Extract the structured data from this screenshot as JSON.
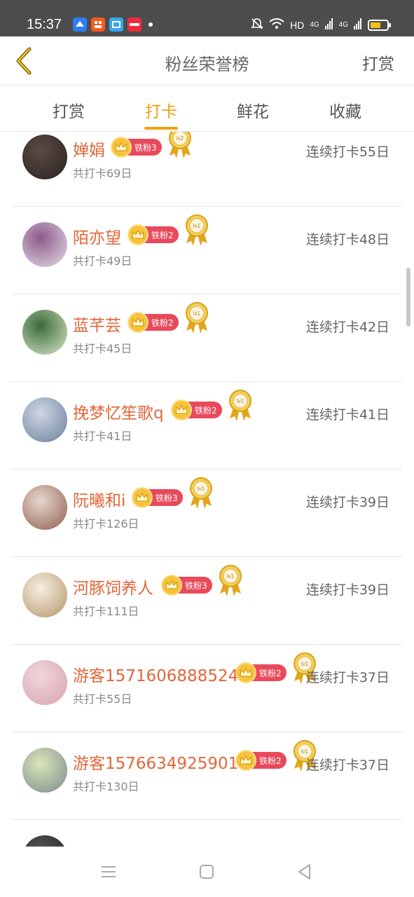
{
  "status_bar": {
    "time": "15:37",
    "network": "HD",
    "signal1": "4G",
    "signal2": "4G",
    "app_icons": [
      "message-app-icon",
      "taobao-icon",
      "alipay-icon",
      "xiaohongshu-icon"
    ]
  },
  "header": {
    "title": "粉丝荣誉榜",
    "right_action": "打赏"
  },
  "tabs": [
    {
      "label": "打赏",
      "active": false
    },
    {
      "label": "打卡",
      "active": true
    },
    {
      "label": "鲜花",
      "active": false
    },
    {
      "label": "收藏",
      "active": false
    }
  ],
  "rows": [
    {
      "name": "婵娟",
      "fan_badge": "铁粉3",
      "medal": "lv2",
      "total": "共打卡69日",
      "streak": "连续打卡55日"
    },
    {
      "name": "陌亦望",
      "fan_badge": "铁粉2",
      "medal": "lv1",
      "total": "共打卡49日",
      "streak": "连续打卡48日"
    },
    {
      "name": "蓝芊芸",
      "fan_badge": "铁粉2",
      "medal": "lv1",
      "total": "共打卡45日",
      "streak": "连续打卡42日"
    },
    {
      "name": "挽梦忆笙歌q",
      "fan_badge": "铁粉2",
      "medal": "lv1",
      "total": "共打卡41日",
      "streak": "连续打卡41日"
    },
    {
      "name": "阮曦和i",
      "fan_badge": "铁粉3",
      "medal": "lv1",
      "total": "共打卡126日",
      "streak": "连续打卡39日"
    },
    {
      "name": "河豚饲养人",
      "fan_badge": "铁粉3",
      "medal": "lv1",
      "total": "共打卡111日",
      "streak": "连续打卡39日"
    },
    {
      "name": "游客1571606888524",
      "fan_badge": "铁粉2",
      "medal": "lv1",
      "total": "共打卡55日",
      "streak": "连续打卡37日"
    },
    {
      "name": "游客1576634925901",
      "fan_badge": "铁粉2",
      "medal": "lv1",
      "total": "共打卡130日",
      "streak": "连续打卡37日"
    }
  ],
  "colors": {
    "accent": "#f0a20f",
    "name": "#e2663a",
    "badge": "#e84a5c",
    "crown": "#f6c33b"
  }
}
